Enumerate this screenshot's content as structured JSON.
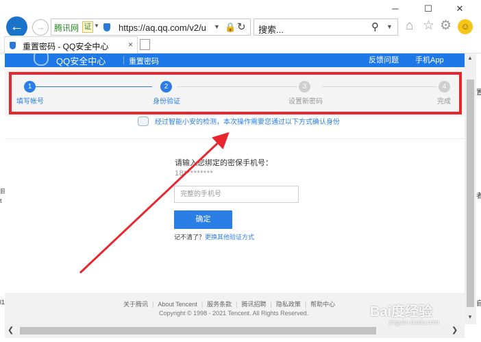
{
  "browser": {
    "url_site_label": "腾讯网",
    "cert_label": "证",
    "url": "https://aq.qq.com/v2/u",
    "search_placeholder": "搜索...",
    "tab_title": "重置密码 - QQ安全中心",
    "tab_close": "×"
  },
  "header": {
    "title": "QQ安全中心",
    "subtitle": "重置密码",
    "links": [
      "反馈问题",
      "手机App"
    ]
  },
  "steps": [
    {
      "num": "1",
      "label": "填写帐号",
      "state": "done"
    },
    {
      "num": "2",
      "label": "身份验证",
      "state": "active"
    },
    {
      "num": "3",
      "label": "设置新密码",
      "state": "todo"
    },
    {
      "num": "4",
      "label": "完成",
      "state": "todo"
    }
  ],
  "notice": "经过智能小安的检测，本次操作需要您通过以下方式确认身份",
  "form": {
    "prompt": "请输入您绑定的密保手机号：",
    "masked_phone": "18*********",
    "phone_placeholder": "完整的手机号",
    "confirm_label": "确定",
    "forgot_text": "记不清了？",
    "other_method_link": "更换其他验证方式"
  },
  "footer": {
    "links": [
      "关于腾讯",
      "About Tencent",
      "服务条款",
      "腾讯招聘",
      "隐私政策",
      "帮助中心"
    ],
    "copyright": "Copyright © 1998 - 2021 Tencent. All Rights Reserved."
  },
  "side_fragments": {
    "right": [
      "置",
      "者",
      "自"
    ],
    "left": [
      "目",
      "t",
      "l1"
    ]
  },
  "watermark": {
    "main": "Bai度经验",
    "sub": "jingyan.baidu.com"
  },
  "colors": {
    "accent": "#2b7ee6",
    "header_bg": "#1f78e8",
    "annotation_red": "#e8262e"
  }
}
